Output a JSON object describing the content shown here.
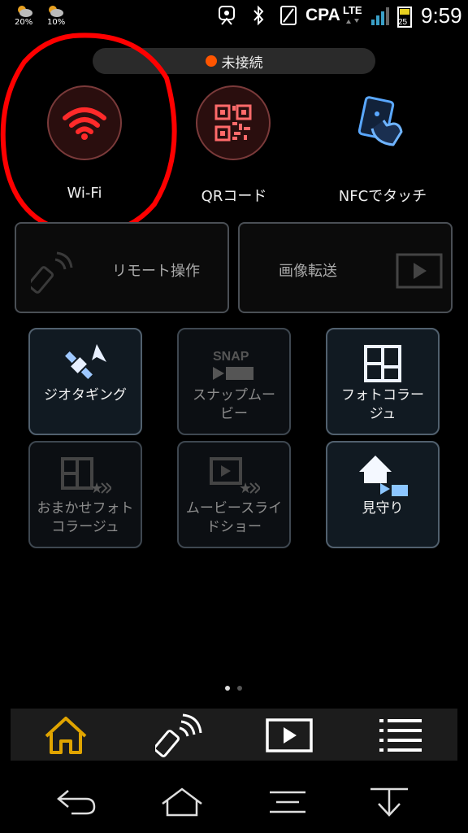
{
  "status_bar": {
    "weather": [
      {
        "icon": "weather-cloud-sun-icon",
        "percent": "20%"
      },
      {
        "icon": "weather-cloud-sun-icon",
        "percent": "10%"
      }
    ],
    "carrier": "CPA",
    "network": "LTE",
    "battery_level": "25",
    "time": "9:59"
  },
  "connection": {
    "status": "未接続",
    "dot_color": "#ff5500"
  },
  "top_actions": [
    {
      "label": "Wi-Fi",
      "icon": "wifi-icon"
    },
    {
      "label": "QRコード",
      "icon": "qr-code-icon"
    },
    {
      "label": "NFCでタッチ",
      "icon": "nfc-touch-icon"
    }
  ],
  "wide_actions": {
    "remote": "リモート操作",
    "transfer": "画像転送"
  },
  "tiles": [
    {
      "label": "ジオタギング",
      "icon": "geotagging-satellite-icon",
      "enabled": true
    },
    {
      "label": "スナップムービー",
      "icon": "snap-movie-icon",
      "enabled": false
    },
    {
      "label": "フォトコラージュ",
      "icon": "photo-collage-icon",
      "enabled": true
    },
    {
      "label": "おまかせフォトコラージュ",
      "icon": "auto-photo-collage-icon",
      "enabled": false
    },
    {
      "label": "ムービースライドショー",
      "icon": "movie-slideshow-icon",
      "enabled": false
    },
    {
      "label": "見守り",
      "icon": "home-monitor-icon",
      "enabled": true
    }
  ],
  "snap_text": "SNAP",
  "tile_labels": {
    "geotag": "ジオタギング",
    "snap_1": "スナップムー",
    "snap_2": "ビー",
    "collage_1": "フォトコラー",
    "collage_2": "ジュ",
    "auto_1": "おまかせフォト",
    "auto_2": "コラージュ",
    "slide_1": "ムービースライ",
    "slide_2": "ドショー",
    "monitor": "見守り"
  },
  "pager": {
    "current": 1,
    "total": 2
  },
  "bottom_tabs": [
    {
      "icon": "home-icon",
      "active": true
    },
    {
      "icon": "remote-control-icon",
      "active": false
    },
    {
      "icon": "playback-icon",
      "active": false
    },
    {
      "icon": "menu-list-icon",
      "active": false
    }
  ],
  "system_nav": [
    "back-icon",
    "home-outline-icon",
    "recent-apps-icon",
    "collapse-icon"
  ],
  "colors": {
    "accent": "#e0a400",
    "highlight_circle": "#ff0000",
    "wifi_red": "#ff2a2a"
  }
}
